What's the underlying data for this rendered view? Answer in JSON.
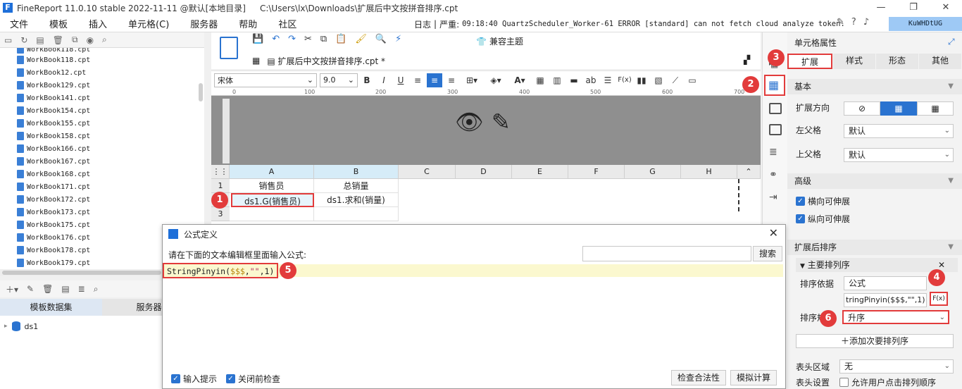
{
  "window": {
    "title": "FineReport 11.0.10 stable 2022-11-11 @默认[本地目录]",
    "path": "C:\\Users\\lx\\Downloads\\扩展后中文按拼音排序.cpt"
  },
  "menu": [
    "文件",
    "模板",
    "插入",
    "单元格(C)",
    "服务器",
    "帮助",
    "社区"
  ],
  "log": {
    "label": "日志",
    "sep": "|",
    "severity": "严重:",
    "message": "09:18:40 QuartzScheduler_Worker-61 ERROR [standard] can not fetch cloud analyze token."
  },
  "user": "KuWHDtUG",
  "files": [
    "WorkBook12.cpt",
    "WorkBook129.cpt",
    "WorkBook141.cpt",
    "WorkBook154.cpt",
    "WorkBook155.cpt",
    "WorkBook158.cpt",
    "WorkBook166.cpt",
    "WorkBook167.cpt",
    "WorkBook168.cpt",
    "WorkBook171.cpt",
    "WorkBook172.cpt",
    "WorkBook173.cpt",
    "WorkBook175.cpt",
    "WorkBook176.cpt",
    "WorkBook178.cpt",
    "WorkBook179.cpt"
  ],
  "files_top": "WorkBook118.cpt",
  "dataset_tabs": {
    "template": "模板数据集",
    "server": "服务器数"
  },
  "dataset": "ds1",
  "toolbar": {
    "compat": "兼容主题",
    "doc_tab": "扩展后中文按拼音排序.cpt *"
  },
  "format": {
    "font": "宋体",
    "size": "9.0",
    "bold": "B",
    "italic": "I",
    "underline": "U",
    "fx": "F(x)",
    "ab": "ab"
  },
  "ruler": [
    "0",
    "100",
    "200",
    "300",
    "400",
    "500",
    "600",
    "700"
  ],
  "sheet": {
    "cols": [
      "A",
      "B",
      "C",
      "D",
      "E",
      "F",
      "G",
      "H"
    ],
    "rows": [
      "1",
      "2",
      "3"
    ],
    "a1": "销售员",
    "b1": "总销量",
    "a2": "ds1.G(销售员)",
    "b2": "ds1.求和(销量)"
  },
  "badges": [
    "1",
    "2",
    "3",
    "4",
    "5",
    "6"
  ],
  "panel": {
    "title": "单元格属性",
    "tabs": [
      "扩展",
      "样式",
      "形态",
      "其他"
    ],
    "basic": "基本",
    "expand_dir": "扩展方向",
    "left_parent": "左父格",
    "left_parent_val": "默认",
    "top_parent": "上父格",
    "top_parent_val": "默认",
    "advanced": "高级",
    "h_ext": "横向可伸展",
    "v_ext": "纵向可伸展",
    "sort_section": "扩展后排序",
    "primary": "主要排列序",
    "sort_basis": "排序依据",
    "sort_basis_val": "公式",
    "formula_val": "tringPinyin($$$,\"\",1)",
    "fx": "F(x)",
    "order_label": "排序规",
    "order_val": "升序",
    "add_secondary": "添加次要排列序",
    "header_area": "表头区域",
    "header_val": "无",
    "header_settings": "表头设置",
    "allow_click": "允许用户点击排列顺序"
  },
  "dialog": {
    "title": "公式定义",
    "prompt": "请在下面的文本编辑框里面输入公式:",
    "search_btn": "搜索",
    "formula_fn": "StringPinyin(",
    "formula_var": "$$$",
    "formula_sep": ",",
    "formula_str": "\"\"",
    "formula_end": ",1)",
    "opt_hint": "输入提示",
    "opt_check": "关闭前检查",
    "btn_validate": "检查合法性",
    "btn_simulate": "模拟计算"
  }
}
